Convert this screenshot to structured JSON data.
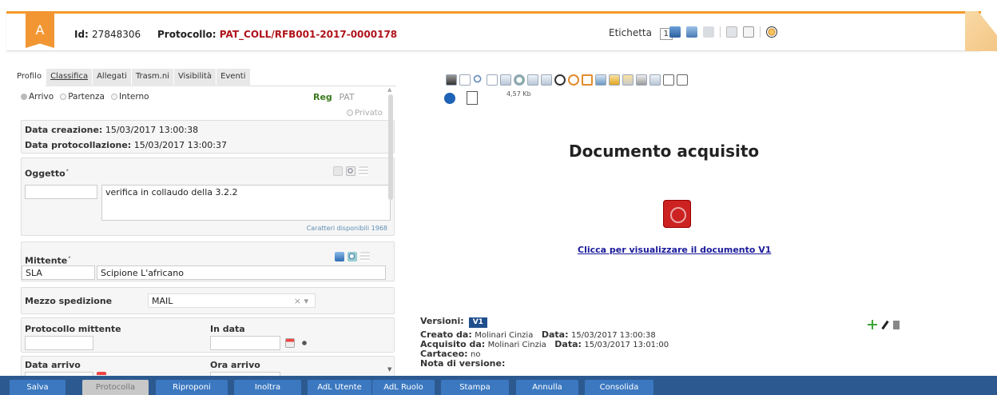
{
  "header": {
    "badge": "A",
    "id_label": "Id:",
    "id_value": "27848306",
    "protocol_label": "Protocollo:",
    "protocol_value": "PAT_COLL/RFB001-2017-0000178",
    "etichetta_label": "Etichetta",
    "etichetta_value": "1"
  },
  "tabs": [
    {
      "label": "Profilo"
    },
    {
      "label": "Classifica"
    },
    {
      "label": "Allegati"
    },
    {
      "label": "Trasm.ni"
    },
    {
      "label": "Visibilità"
    },
    {
      "label": "Eventi"
    }
  ],
  "radios": {
    "arrivo": "Arrivo",
    "partenza": "Partenza",
    "interno": "Interno",
    "selected": "Arrivo"
  },
  "registro": {
    "label": "Reg",
    "value": "PAT",
    "privato": "Privato"
  },
  "dates": {
    "creazione_label": "Data creazione:",
    "creazione_value": "15/03/2017 13:00:38",
    "protocollazione_label": "Data protocollazione:",
    "protocollazione_value": "15/03/2017 13:00:37"
  },
  "oggetto": {
    "label": "Oggetto",
    "code": "",
    "text": "verifica in collaudo della 3.2.2",
    "chars": "Caratteri disponibili 1968"
  },
  "mittente": {
    "label": "Mittente",
    "code": "SLA",
    "name": "Scipione L'africano"
  },
  "mezzo": {
    "label": "Mezzo spedizione",
    "value": "MAIL",
    "clear": "×",
    "caret": "▾"
  },
  "protocollo_mittente": {
    "label": "Protocollo mittente",
    "value": "",
    "in_data_label": "In data",
    "in_data_value": ""
  },
  "arrivo": {
    "data_label": "Data arrivo",
    "ora_label": "Ora arrivo"
  },
  "viewer": {
    "size": "4,57 Kb",
    "title": "Documento acquisito",
    "link": "Clicca per visualizzare il documento V1"
  },
  "versioni": {
    "label": "Versioni:",
    "badge": "V1",
    "creato_label": "Creato da:",
    "creato_value": "Molinari Cinzia",
    "creato_data_label": "Data:",
    "creato_data_value": "15/03/2017 13:00:38",
    "acquisito_label": "Acquisito da:",
    "acquisito_value": "Molinari Cinzia",
    "acquisito_data_label": "Data:",
    "acquisito_data_value": "15/03/2017 13:01:00",
    "cartaceo_label": "Cartaceo:",
    "cartaceo_value": "no",
    "nota_label": "Nota di versione:"
  },
  "buttons": [
    {
      "label": "Salva",
      "enabled": true
    },
    {
      "label": "Protocolla",
      "enabled": false
    },
    {
      "label": "Riproponi",
      "enabled": true
    },
    {
      "label": "Inoltra",
      "enabled": true
    },
    {
      "label": "AdL Utente",
      "enabled": true
    },
    {
      "label": "AdL Ruolo",
      "enabled": true
    },
    {
      "label": "Stampa",
      "enabled": true
    },
    {
      "label": "Annulla",
      "enabled": true
    },
    {
      "label": "Consolida",
      "enabled": true
    }
  ],
  "colors": {
    "accent": "#f29633",
    "protocol": "#b0121b",
    "bar": "#2c5a90",
    "button": "#3b78c0",
    "link": "#1a1a9a"
  }
}
